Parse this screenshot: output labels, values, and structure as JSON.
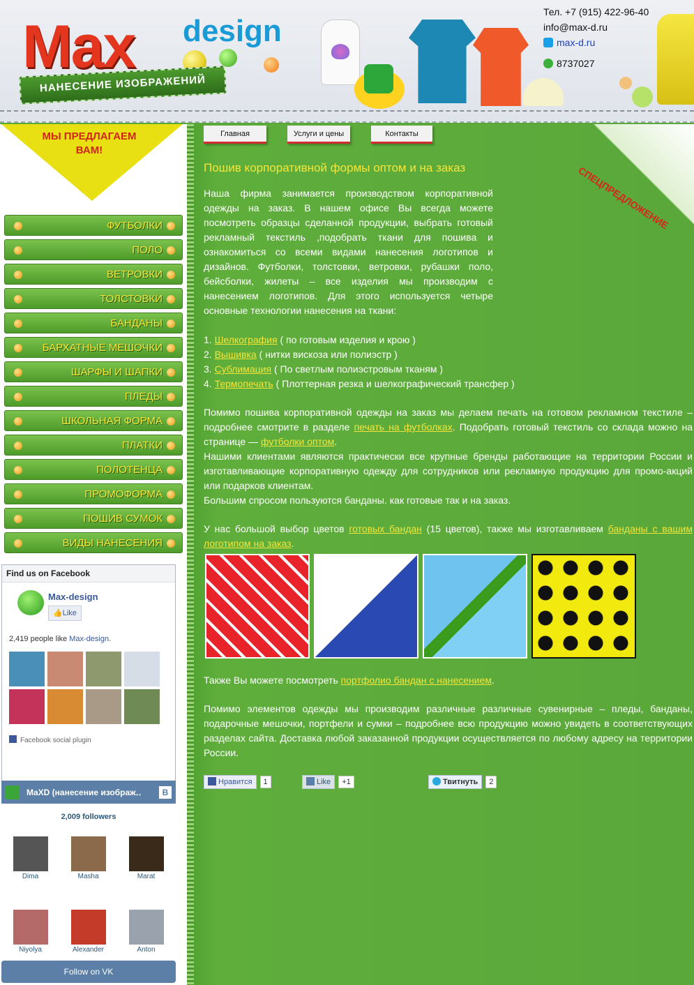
{
  "header": {
    "logo_max": "Max",
    "logo_design": "design",
    "logo_tagline": "НАНЕСЕНИЕ ИЗОБРАЖЕНИЙ",
    "phone": "Тел. +7 (915) 422-96-40",
    "email": "info@max-d.ru",
    "skype": "max-d.ru",
    "icq": "8737027"
  },
  "offer": {
    "text": "МЫ ПРЕДЛАГАЕМ ВАМ!"
  },
  "categories": [
    "ФУТБОЛКИ",
    "ПОЛО",
    "ВЕТРОВКИ",
    "ТОЛСТОВКИ",
    "БАНДАНЫ",
    "БАРХАТНЫЕ МЕШОЧКИ",
    "ШАРФЫ И ШАПКИ",
    "ПЛЕДЫ",
    "ШКОЛЬНАЯ ФОРМА",
    "ПЛАТКИ",
    "ПОЛОТЕНЦА",
    "ПРОМОФОРМА",
    "ПОШИВ СУМОК",
    "ВИДЫ НАНЕСЕНИЯ"
  ],
  "facebook": {
    "header": "Find us on Facebook",
    "page_name": "Max-design",
    "like_label": "Like",
    "people_count": "2,419 people like",
    "people_page": "Max-design.",
    "plugin_label": "Facebook social plugin"
  },
  "vk": {
    "title": "MaXD (нанесение изображ‥",
    "badge": "B",
    "followers": "2,009 followers",
    "people": [
      "Dima",
      "Masha",
      "Marat",
      "Niyolya",
      "Alexander",
      "Anton"
    ],
    "follow_label": "Follow on VK"
  },
  "nav": {
    "home": "Главная",
    "services": "Услуги и цены",
    "contacts": "Контакты"
  },
  "promo": "СПЕЦПРЕДЛОЖЕНИЕ",
  "content": {
    "title": "Пошив корпоративной формы оптом и на заказ",
    "intro": "Наша фирма занимается производством корпоративной одежды на заказ. В нашем офисе Вы всегда можете посмотреть образцы сделанной продукции, выбрать готовый рекламный текстиль ,подобрать ткани для пошива и ознакомиться со всеми видами нанесения логотипов и дизайнов. Футболки, толстовки, ветровки, рубашки поло, бейсболки, жилеты – все изделия мы производим с нанесением логотипов. Для этого используется четыре основные технологии нанесения на ткани:",
    "techniques": [
      {
        "num": "1.",
        "link": "Шелкография",
        "desc": " ( по готовым изделия и крою )"
      },
      {
        "num": "2.",
        "link": "Вышивка",
        "desc": " ( нитки вискоза или полиэстр )"
      },
      {
        "num": "3.",
        "link": "Сублимация",
        "desc": " ( По светлым полиэстровым тканям )"
      },
      {
        "num": "4.",
        "link": "Термопечать",
        "desc": " ( Плоттерная резка и шелкографический трансфер )"
      }
    ],
    "print_p1_a": "Помимо пошива корпоративной одежды на заказ мы делаем печать на готовом рекламном текстиле – подробнее смотрите в разделе ",
    "print_p1_link": "печать на футболках",
    "print_p1_b": ". Подобрать готовый текстиль со склада можно на странице — ",
    "print_p1_link2": "футболки оптом",
    "print_p1_c": ".",
    "print_p2": "Нашими клиентами являются практически все крупные бренды работающие на территории России и изготавливающие корпоративную одежду для сотрудников или рекламную продукцию для промо-акций или подарков клиентам.",
    "print_p3": "Большим спросом пользуются банданы. как готовые так и на заказ.",
    "bandana_a": "У нас большой выбор цветов ",
    "bandana_link1": "готовых бандан",
    "bandana_b": " (15 цветов), также мы изготавливаем ",
    "bandana_link2": "банданы с вашим логотипом на заказ",
    "bandana_c": ".",
    "portfolio_a": "Также Вы можете посмотреть ",
    "portfolio_link": "портфолио бандан с нанесением",
    "portfolio_b": ".",
    "souvenir": "Помимо элементов одежды мы производим различные различные сувенирные – пледы, банданы, подарочные мешочки, портфели и сумки – подробнее всю продукцию можно увидеть в соответствующих разделах сайта.  Доставка любой заказанной продукции осуществляется по любому адресу на территории России."
  },
  "social": {
    "fb_label": "Нравится",
    "fb_count": "1",
    "vk_label": "Like",
    "vk_count": "+1",
    "tw_label": "Твитнуть",
    "tw_count": "2"
  }
}
